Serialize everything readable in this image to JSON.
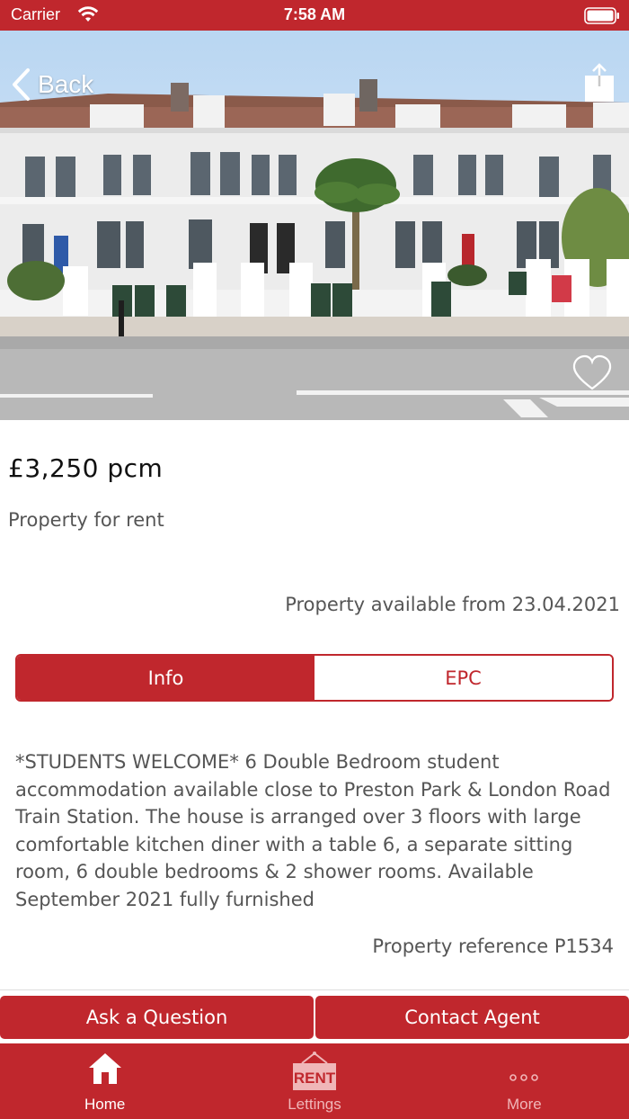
{
  "status_bar": {
    "carrier": "Carrier",
    "time": "7:58 AM"
  },
  "nav": {
    "back_label": "Back"
  },
  "listing": {
    "price": "£3,250 pcm",
    "type": "Property for rent",
    "available": "Property available from 23.04.2021",
    "description": "*STUDENTS WELCOME* 6 Double Bedroom student accommodation available close to Preston Park & London Road Train Station. The house is arranged over 3 floors with large comfortable kitchen diner with a table 6, a separate sitting room, 6 double bedrooms & 2 shower rooms. Available September 2021 fully furnished",
    "reference": "Property reference P1534"
  },
  "segments": [
    {
      "label": "Info",
      "active": true
    },
    {
      "label": "EPC",
      "active": false
    }
  ],
  "actions": {
    "ask_label": "Ask a Question",
    "contact_label": "Contact Agent"
  },
  "tabbar": {
    "items": [
      {
        "label": "Home",
        "icon": "house-icon",
        "selected": true
      },
      {
        "label": "Lettings",
        "icon": "rent-sign-icon",
        "icon_text": "RENT",
        "selected": false
      },
      {
        "label": "More",
        "icon": "ellipsis-icon",
        "selected": false
      }
    ]
  },
  "colors": {
    "brand": "#c0272d",
    "text": "#555555",
    "background": "#ffffff"
  }
}
